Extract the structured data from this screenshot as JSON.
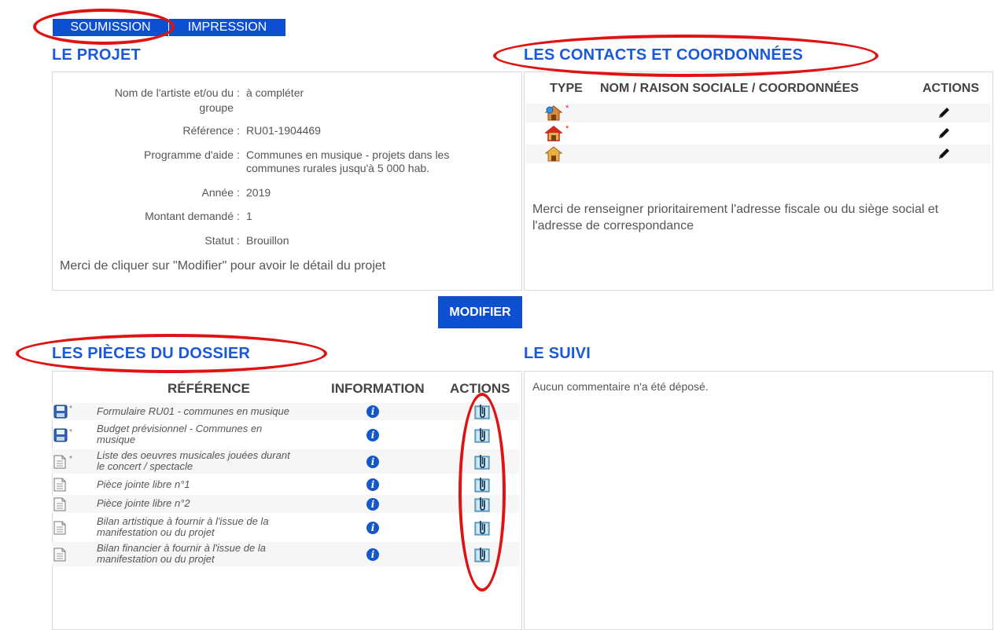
{
  "tabs": {
    "submission": "SOUMISSION",
    "print": "IMPRESSION"
  },
  "project": {
    "title": "LE PROJET",
    "fields": [
      {
        "label": "Nom de l'artiste et/ou du",
        "label2": "groupe",
        "value": "à compléter"
      },
      {
        "label": "Référence",
        "value": "RU01-1904469"
      },
      {
        "label": "Programme d'aide",
        "value": "Communes en musique - projets dans les",
        "value2": "communes rurales jusqu'à 5 000 hab."
      },
      {
        "label": "Année",
        "value": "2019"
      },
      {
        "label": "Montant demandé",
        "value": "1"
      },
      {
        "label": "Statut",
        "value": "Brouillon"
      }
    ],
    "colon": ":",
    "note": "Merci de cliquer sur \"Modifier\" pour avoir le détail du projet"
  },
  "contacts": {
    "title": "LES CONTACTS ET COORDONNÉES",
    "headers": {
      "type": "TYPE",
      "name": "NOM / RAISON SOCIALE / COORDONNÉES",
      "actions": "ACTIONS"
    },
    "rows": [
      {
        "icon": "house-globe-icon",
        "required": "*"
      },
      {
        "icon": "house-red-icon",
        "required": "*"
      },
      {
        "icon": "house-icon",
        "required": ""
      }
    ],
    "note": "Merci de renseigner prioritairement l'adresse fiscale ou du siège social et",
    "note2": "l'adresse de correspondance"
  },
  "modify_button": "MODIFIER",
  "pieces": {
    "title": "LES PIÈCES DU DOSSIER",
    "headers": {
      "reference": "RÉFÉRENCE",
      "information": "INFORMATION",
      "actions": "ACTIONS"
    },
    "rows": [
      {
        "icon": "floppy-icon",
        "required": "*",
        "line1": "Formulaire RU01 - communes en musique",
        "line2": ""
      },
      {
        "icon": "floppy-icon",
        "required": "*",
        "line1": "Budget prévisionnel - Communes en",
        "line2": "musique"
      },
      {
        "icon": "document-icon",
        "required": "*",
        "line1": "Liste des oeuvres musicales jouées durant",
        "line2": "le concert / spectacle"
      },
      {
        "icon": "document-icon",
        "required": "",
        "line1": "Pièce jointe libre n°1",
        "line2": ""
      },
      {
        "icon": "document-icon",
        "required": "",
        "line1": "Pièce jointe libre n°2",
        "line2": ""
      },
      {
        "icon": "document-icon",
        "required": "",
        "line1": "Bilan artistique à fournir à l'issue de la",
        "line2": "manifestation ou du projet"
      },
      {
        "icon": "document-icon",
        "required": "",
        "line1": "Bilan financier à fournir à l'issue de la",
        "line2": "manifestation ou du projet"
      }
    ],
    "info_glyph": "i"
  },
  "followup": {
    "title": "LE SUIVI",
    "empty": "Aucun commentaire n'a été déposé."
  },
  "colors": {
    "accent": "#0d4fd1",
    "title": "#1a5ad7",
    "highlight": "#e01313"
  }
}
